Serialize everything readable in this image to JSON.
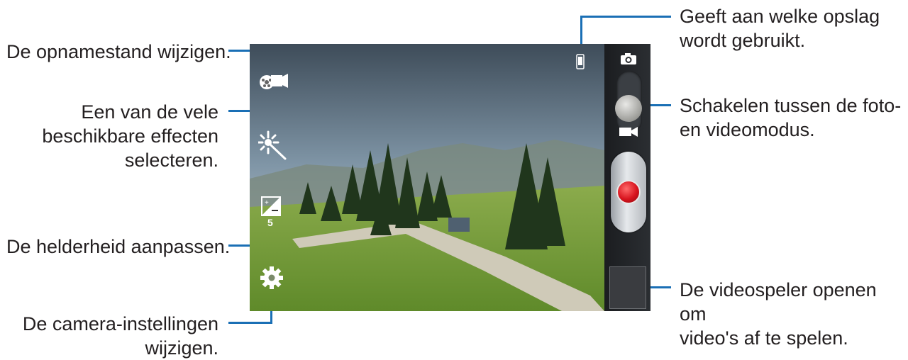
{
  "callouts": {
    "recording_mode": "De opnamestand wijzigen.",
    "effects_line1": "Een van de vele",
    "effects_line2": "beschikbare effecten",
    "effects_line3": "selecteren.",
    "brightness": "De helderheid aanpassen.",
    "settings_line1": "De camera-instellingen",
    "settings_line2": "wijzigen.",
    "storage_line1": "Geeft aan welke opslag",
    "storage_line2": "wordt gebruikt.",
    "switch_line1": "Schakelen tussen de foto-",
    "switch_line2": "en videomodus.",
    "player_line1": "De videospeler openen om",
    "player_line2": "video's af te spelen."
  },
  "screen": {
    "brightness_value": "5"
  },
  "icons": {
    "recording_mode": "video-reel-icon",
    "effects": "magic-wand-icon",
    "brightness": "exposure-icon",
    "settings": "gear-icon",
    "storage": "phone-storage-icon",
    "photo_mode": "camera-icon",
    "video_mode": "video-camera-icon",
    "record": "record-button"
  },
  "colors": {
    "leader": "#1a6fb5",
    "record": "#d8141e",
    "sidebar": "#1b1d20"
  }
}
